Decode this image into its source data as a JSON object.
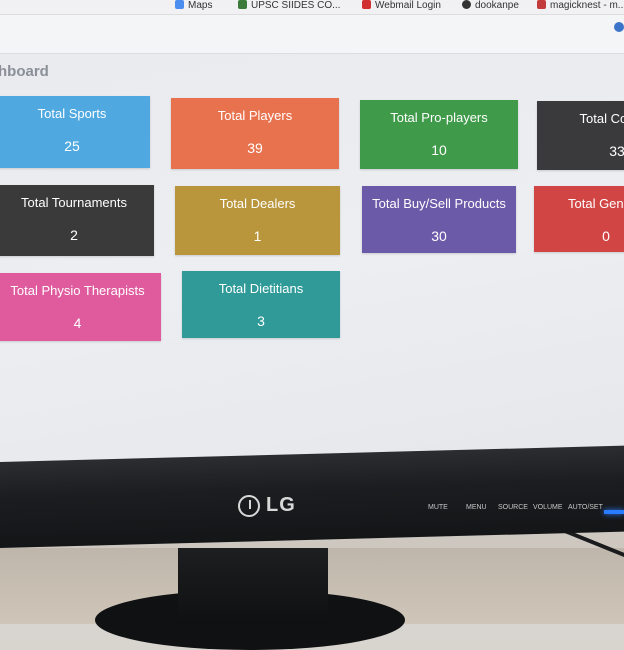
{
  "browser": {
    "bookmarks": [
      {
        "label": "Maps",
        "color": "#4b8ef0"
      },
      {
        "label": "UPSC SIIDES CO...",
        "color": "#3b7a3b"
      },
      {
        "label": "Webmail Login",
        "color": "#d03030"
      },
      {
        "label": "dookanpe",
        "color": "#333333"
      },
      {
        "label": "magicknest - m...",
        "color": "#c23a3a"
      }
    ]
  },
  "dashboard": {
    "title": "hboard",
    "cards": [
      {
        "label": "Total Sports",
        "value": "25",
        "color": "#4fa8e0"
      },
      {
        "label": "Total Players",
        "value": "39",
        "color": "#e8724e"
      },
      {
        "label": "Total Pro-players",
        "value": "10",
        "color": "#3f9a4a"
      },
      {
        "label": "Total Coa",
        "value": "33",
        "color": "#3a3a3c"
      },
      {
        "label": "Total Tournaments",
        "value": "2",
        "color": "#3b3a3b"
      },
      {
        "label": "Total Dealers",
        "value": "1",
        "color": "#b9963c"
      },
      {
        "label": "Total Buy/Sell Products",
        "value": "30",
        "color": "#6b5aa8"
      },
      {
        "label": "Total General P",
        "value": "0",
        "color": "#d24545"
      },
      {
        "label": "Total Physio Therapists",
        "value": "4",
        "color": "#df5b9e"
      },
      {
        "label": "Total Dietitians",
        "value": "3",
        "color": "#2f9a98"
      }
    ]
  },
  "monitor": {
    "brand": "LG",
    "controls": [
      "MUTE",
      "MENU",
      "SOURCE",
      "VOLUME",
      "AUTO/SET"
    ]
  }
}
